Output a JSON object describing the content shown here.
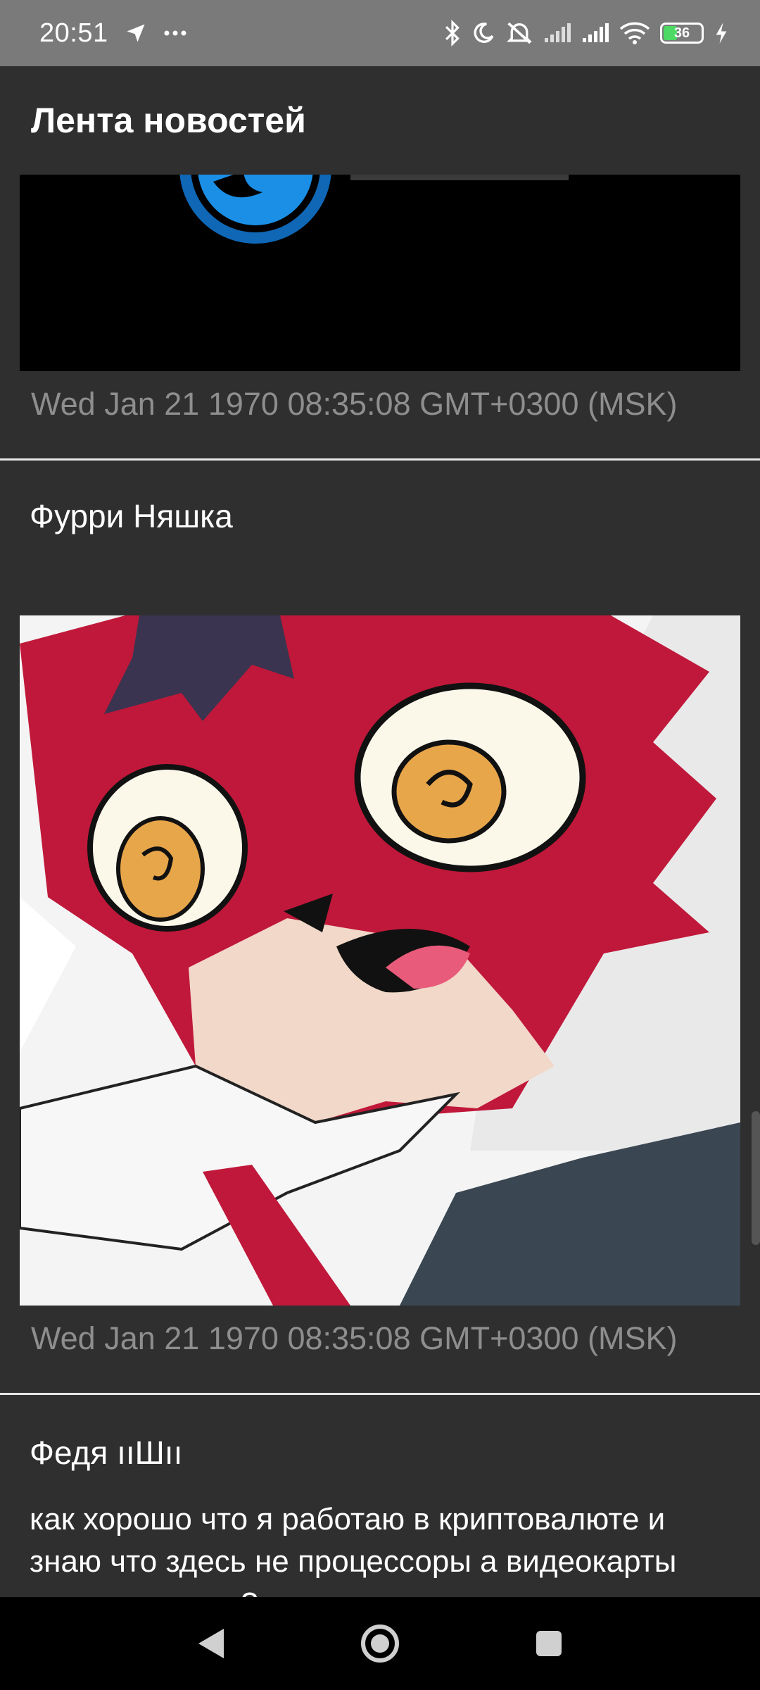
{
  "status_bar": {
    "time": "20:51",
    "battery_level": "36",
    "icons": [
      "navigation-icon",
      "more-dots-icon",
      "bluetooth-icon",
      "moon-icon",
      "mute-icon",
      "signal-icon",
      "signal-icon",
      "wifi-icon",
      "battery-icon",
      "charging-icon"
    ]
  },
  "app_bar": {
    "title": "Лента новостей"
  },
  "feed": {
    "posts": [
      {
        "date": "Wed Jan 21 1970 08:35:08 GMT+0300 (MSK)"
      },
      {
        "author": "Фурри Няшка",
        "date": "Wed Jan 21 1970 08:35:08 GMT+0300 (MSK)"
      },
      {
        "author": "Федя ııШıı",
        "text": "как хорошо что я работаю в криптовалюте и знаю что здесь не процессоры а видеокарты стоят, и их тут ?"
      }
    ]
  },
  "nav_bar": {
    "icons": [
      "back-icon",
      "home-icon",
      "recents-icon"
    ]
  },
  "colors": {
    "accent_red": "#c0183a",
    "background": "#2f2f2f",
    "status_bar": "#7a7a7a"
  }
}
